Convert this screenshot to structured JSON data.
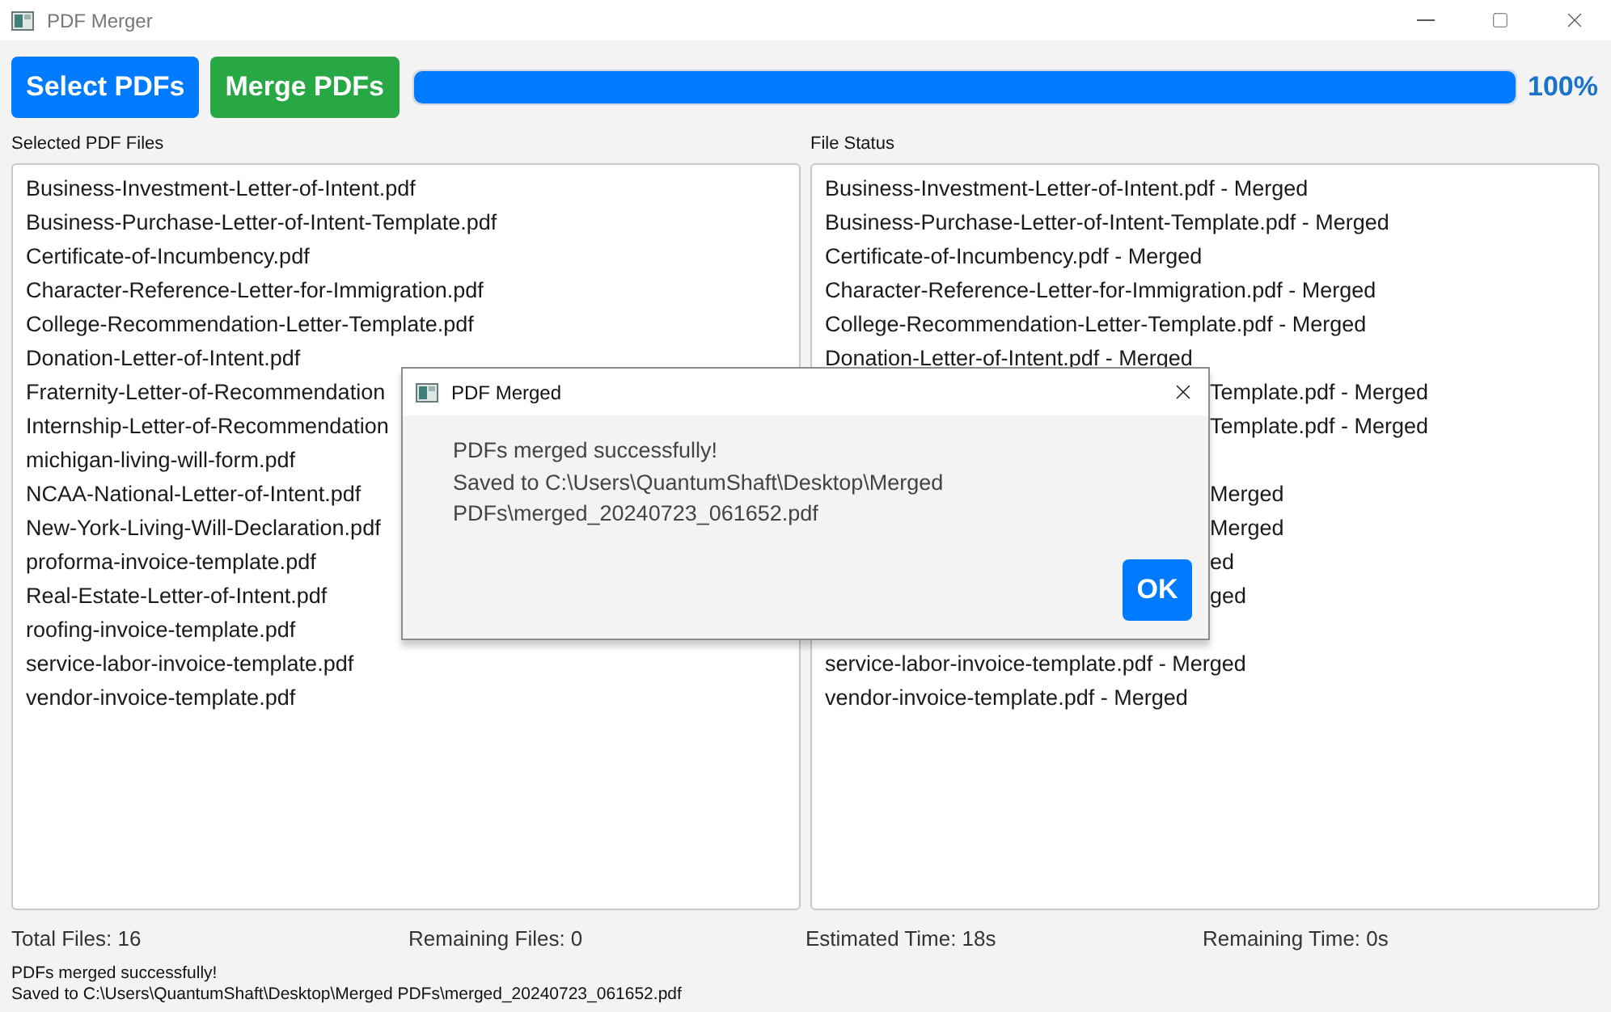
{
  "window": {
    "title": "PDF Merger"
  },
  "toolbar": {
    "buttons": [
      {
        "label": "Select PDFs",
        "kind": "select"
      },
      {
        "label": "Merge PDFs",
        "kind": "merge"
      }
    ],
    "progress": {
      "level": 1.0,
      "reading": "100%"
    }
  },
  "selected_files": {
    "label": "Selected PDF Files",
    "items": [
      {
        "text": "Business-Investment-Letter-of-Intent.pdf"
      },
      {
        "text": "Business-Purchase-Letter-of-Intent-Template.pdf"
      },
      {
        "text": "Certificate-of-Incumbency.pdf"
      },
      {
        "text": "Character-Reference-Letter-for-Immigration.pdf"
      },
      {
        "text": "College-Recommendation-Letter-Template.pdf"
      },
      {
        "text": "Donation-Letter-of-Intent.pdf"
      },
      {
        "text": "Fraternity-Letter-of-Recommendation"
      },
      {
        "text": "Internship-Letter-of-Recommendation"
      },
      {
        "text": "michigan-living-will-form.pdf"
      },
      {
        "text": "NCAA-National-Letter-of-Intent.pdf"
      },
      {
        "text": "New-York-Living-Will-Declaration.pdf"
      },
      {
        "text": "proforma-invoice-template.pdf"
      },
      {
        "text": "Real-Estate-Letter-of-Intent.pdf"
      },
      {
        "text": "roofing-invoice-template.pdf"
      },
      {
        "text": "service-labor-invoice-template.pdf"
      },
      {
        "text": "vendor-invoice-template.pdf"
      }
    ]
  },
  "file_status": {
    "label": "File Status",
    "items": [
      {
        "text": "Business-Investment-Letter-of-Intent.pdf - Merged",
        "covered": false
      },
      {
        "text": "Business-Purchase-Letter-of-Intent-Template.pdf - Merged",
        "covered": false
      },
      {
        "text": "Certificate-of-Incumbency.pdf - Merged",
        "covered": false
      },
      {
        "text": "Character-Reference-Letter-for-Immigration.pdf - Merged",
        "covered": false
      },
      {
        "text": "College-Recommendation-Letter-Template.pdf - Merged",
        "covered": false
      },
      {
        "text": "Donation-Letter-of-Intent.pdf - Merged",
        "covered": false
      },
      {
        "text": "Template.pdf - Merged",
        "covered": true
      },
      {
        "text": "Template.pdf - Merged",
        "covered": true
      },
      {
        "covered": true
      },
      {
        "text": "Merged",
        "covered": true
      },
      {
        "text": "Merged",
        "covered": true
      },
      {
        "text": "ed",
        "covered": true
      },
      {
        "text": "ged",
        "covered": true
      },
      {
        "covered": true
      },
      {
        "text": "service-labor-invoice-template.pdf - Merged",
        "covered": false
      },
      {
        "text": "vendor-invoice-template.pdf - Merged",
        "covered": false
      }
    ]
  },
  "stats": [
    "Total Files: 16",
    "Remaining Files: 0",
    "Estimated Time: 18s",
    "Remaining Time: 0s"
  ],
  "status_message": [
    "PDFs merged successfully!",
    "Saved to C:\\Users\\QuantumShaft\\Desktop\\Merged PDFs\\merged_20240723_061652.pdf"
  ],
  "dialog": {
    "title": "PDF Merged",
    "message": [
      "PDFs merged successfully!",
      "Saved to C:\\Users\\QuantumShaft\\Desktop\\Merged",
      "PDFs\\merged_20240723_061652.pdf"
    ],
    "button": "OK"
  }
}
